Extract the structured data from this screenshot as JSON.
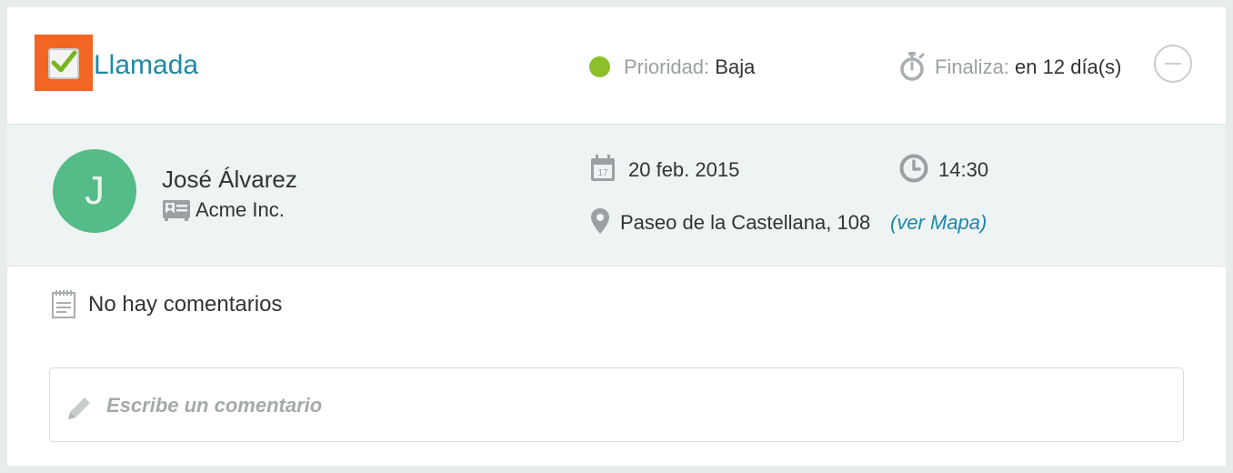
{
  "task": {
    "title": "Llamada",
    "completed": true,
    "priority_label": "Prioridad:",
    "priority_value": "Baja",
    "priority_color": "#8cbf2a",
    "due_label": "Finaliza:",
    "due_value": "en 12 día(s)"
  },
  "contact": {
    "initial": "J",
    "name": "José Álvarez",
    "company": "Acme Inc.",
    "avatar_color": "#55bb88"
  },
  "schedule": {
    "calendar_day": "17",
    "date": "20 feb. 2015",
    "time": "14:30",
    "address": "Paseo de la Castellana, 108",
    "map_link": "(ver Mapa)"
  },
  "comments": {
    "empty_text": "No hay comentarios",
    "placeholder": "Escribe un comentario"
  },
  "icons": [
    "checkbox-checked-icon",
    "stopwatch-icon",
    "minus-circle-icon",
    "id-card-icon",
    "calendar-icon",
    "clock-icon",
    "map-pin-icon",
    "notepad-icon",
    "pencil-icon"
  ],
  "colors": {
    "accent": "#1e88a8",
    "highlight": "#f26522"
  }
}
